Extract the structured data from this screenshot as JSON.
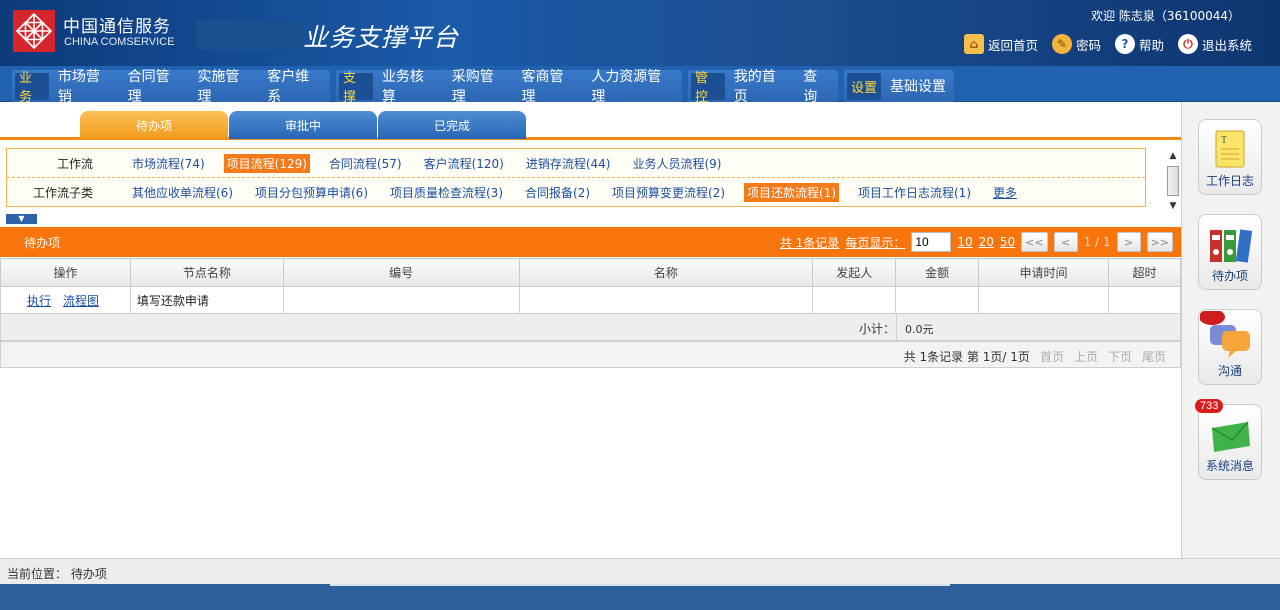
{
  "header": {
    "logo_cn": "中国通信服务",
    "logo_en": "CHINA COMSERVICE",
    "platform_title": "业务支撑平台",
    "welcome": "欢迎 陈志泉（36100044）",
    "actions": [
      {
        "label": "返回首页",
        "icon": "home-icon"
      },
      {
        "label": "密码",
        "icon": "key-icon"
      },
      {
        "label": "帮助",
        "icon": "help-icon"
      },
      {
        "label": "退出系统",
        "icon": "power-icon"
      }
    ]
  },
  "nav": {
    "groups": [
      {
        "tag": "业务",
        "items": [
          "市场营销",
          "合同管理",
          "实施管理",
          "客户维系"
        ]
      },
      {
        "tag": "支撑",
        "items": [
          "业务核算",
          "采购管理",
          "客商管理",
          "人力资源管理"
        ]
      },
      {
        "tag": "管控",
        "items": [
          "我的首页",
          "查询"
        ]
      },
      {
        "tag": "设置",
        "items": [
          "基础设置"
        ]
      }
    ]
  },
  "tabs": [
    "待办项",
    "审批中",
    "已完成"
  ],
  "filter": {
    "row1_label": "工作流",
    "row1_items": [
      "市场流程(74)",
      "项目流程(129)",
      "合同流程(57)",
      "客户流程(120)",
      "进销存流程(44)",
      "业务人员流程(9)"
    ],
    "row2_label": "工作流子类",
    "row2_items": [
      "其他应收单流程(6)",
      "项目分包预算申请(6)",
      "项目质量检查流程(3)",
      "合同报备(2)",
      "项目预算变更流程(2)",
      "项目还款流程(1)",
      "项目工作日志流程(1)"
    ],
    "more": "更多"
  },
  "listbar": {
    "title": "待办项",
    "total_records": "共 1条记录",
    "per_page_label": "每页显示：",
    "per_page_value": "10",
    "page_sizes": [
      "10",
      "20",
      "50"
    ],
    "first": "<<",
    "prev": "<",
    "page_info": "1 / 1",
    "next": ">",
    "last": ">>"
  },
  "table": {
    "headers": [
      "操作",
      "节点名称",
      "编号",
      "名称",
      "发起人",
      "金额",
      "申请时间",
      "超时"
    ],
    "rows": [
      {
        "execute": "执行",
        "flowchart": "流程图",
        "node": "填写还款申请",
        "code": "",
        "name": "",
        "initiator": "",
        "amount": "",
        "apply_time": "",
        "timeout": ""
      }
    ],
    "subtotal_label": "小计：",
    "subtotal_value": "0.0元"
  },
  "bottom_pager": {
    "summary": "共 1条记录 第 1页/ 1页",
    "first": "首页",
    "prev": "上页",
    "next": "下页",
    "last": "尾页"
  },
  "sidebar": [
    {
      "label": "工作日志",
      "icon": "notepad-icon",
      "badge": ""
    },
    {
      "label": "待办项",
      "icon": "binders-icon",
      "badge": ""
    },
    {
      "label": "沟通",
      "icon": "chat-bubbles-icon",
      "badge": ""
    },
    {
      "label": "系统消息",
      "icon": "envelope-icon",
      "badge": "733"
    }
  ],
  "status": {
    "breadcrumb": "当前位置：  待办项"
  },
  "colors": {
    "header_blue": "#1a5aa8",
    "nav_blue": "#2061b0",
    "orange": "#f8740c",
    "selected_filter": "#f57a1a",
    "link_blue": "#1c4ea0"
  }
}
